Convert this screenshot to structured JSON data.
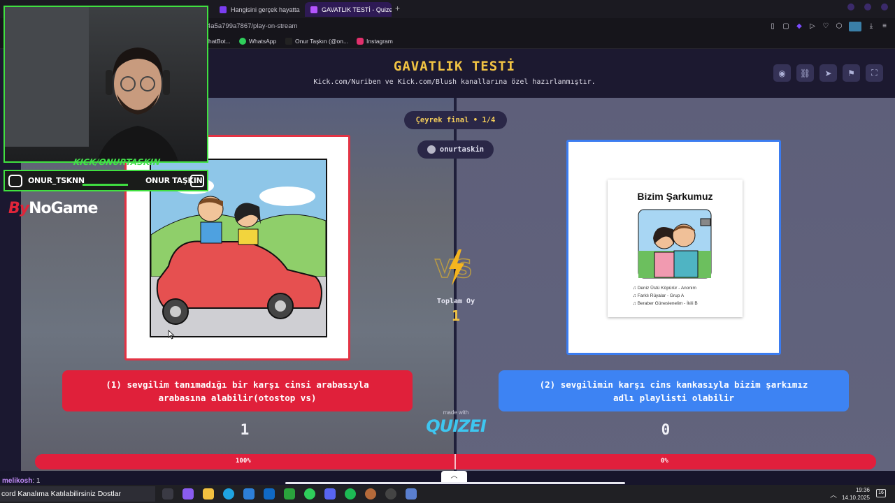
{
  "browser": {
    "tabs": [
      {
        "label": "Hangisini gerçek hayatta",
        "active": false
      },
      {
        "label": "GAVATLIK TESTİ - Quizei",
        "active": true
      }
    ],
    "new_tab": "+",
    "url": "4a5a799a7867/play-on-stream",
    "bookmarks": [
      {
        "label": "hatBot...",
        "icon": "bot-icon"
      },
      {
        "label": "WhatsApp",
        "icon": "whatsapp-icon"
      },
      {
        "label": "Onur Taşkın (@on...",
        "icon": "tiktok-icon"
      },
      {
        "label": "Instagram",
        "icon": "instagram-icon"
      }
    ]
  },
  "quiz": {
    "title": "GAVATLIK TESTİ",
    "subtitle": "Kick.com/Nuriben ve Kick.com/Blush kanallarına özel hazırlanmıştır.",
    "round": "Çeyrek final • 1/4",
    "player": "onurtaskin",
    "total_label": "Toplam Oy",
    "total_votes": "1",
    "made_with": "made with",
    "brand": "QUIZEI",
    "options": [
      {
        "text": "(1) sevgilim tanımadığı bir karşı cinsi arabasıyla arabasına alabilir(otostop vs)",
        "votes": "1",
        "percent_label": "100%",
        "percent": 100,
        "color": "#e0203a"
      },
      {
        "text": "(2) sevgilimin karşı cins kankasıyla bizim şarkımız adlı playlisti olabilir",
        "votes": "0",
        "percent_label": "0%",
        "percent": 0,
        "color": "#3d83f3"
      }
    ],
    "right_card": {
      "heading": "Bizim Şarkumuz",
      "songs": [
        "Deniz Üstü Köpürür - Anonim",
        "Farklı Rüyalar - Grup A",
        "Beraber Güneslenelim - İkili B"
      ]
    }
  },
  "overlay": {
    "kick_tag": "KICK/ONURTASKIN",
    "instagram_handle": "ONUR_TSKNN",
    "youtube_name": "ONUR TAŞKIN",
    "sponsor_a": "By",
    "sponsor_b": "NoGame",
    "chat_user": "melikosh",
    "chat_msg": ": 1"
  },
  "taskbar": {
    "banner": "cord Kanalıma Katılabilirsiniz Dostlar",
    "time": "19:36",
    "date": "14.10.2025",
    "notifications": "16"
  },
  "colors": {
    "accent": "#f2c443",
    "left": "#e0203a",
    "right": "#3d83f3",
    "cam_border": "#40e040"
  }
}
